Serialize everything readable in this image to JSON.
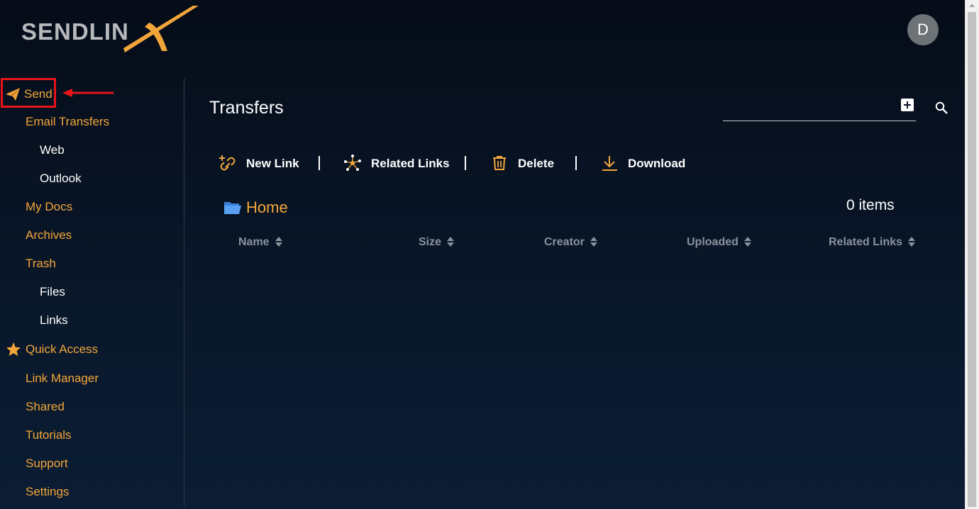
{
  "brand": {
    "logo_text": "SENDLIN",
    "logo_accent": "X",
    "accent_color": "#f2a63a"
  },
  "user": {
    "avatar_initial": "D"
  },
  "sidebar": {
    "send_label": "Send",
    "items": [
      {
        "label": "Email Transfers",
        "level": 1
      },
      {
        "label": "Web",
        "level": 2
      },
      {
        "label": "Outlook",
        "level": 2
      },
      {
        "label": "My Docs",
        "level": 1
      },
      {
        "label": "Archives",
        "level": 1
      },
      {
        "label": "Trash",
        "level": 1
      },
      {
        "label": "Files",
        "level": 2
      },
      {
        "label": "Links",
        "level": 2
      },
      {
        "label": "Quick Access",
        "level": 1,
        "icon": "star-icon"
      },
      {
        "label": "Link Manager",
        "level": 1
      },
      {
        "label": "Shared",
        "level": 1
      },
      {
        "label": "Tutorials",
        "level": 1
      },
      {
        "label": "Support",
        "level": 1
      },
      {
        "label": "Settings",
        "level": 1
      }
    ]
  },
  "main": {
    "title": "Transfers",
    "search": {
      "placeholder": ""
    },
    "toolbar": {
      "new_link": "New Link",
      "related_links": "Related Links",
      "delete": "Delete",
      "download": "Download"
    },
    "breadcrumb": {
      "home": "Home"
    },
    "item_count": "0 items",
    "columns": [
      "Name",
      "Size",
      "Creator",
      "Uploaded",
      "Related Links"
    ]
  }
}
